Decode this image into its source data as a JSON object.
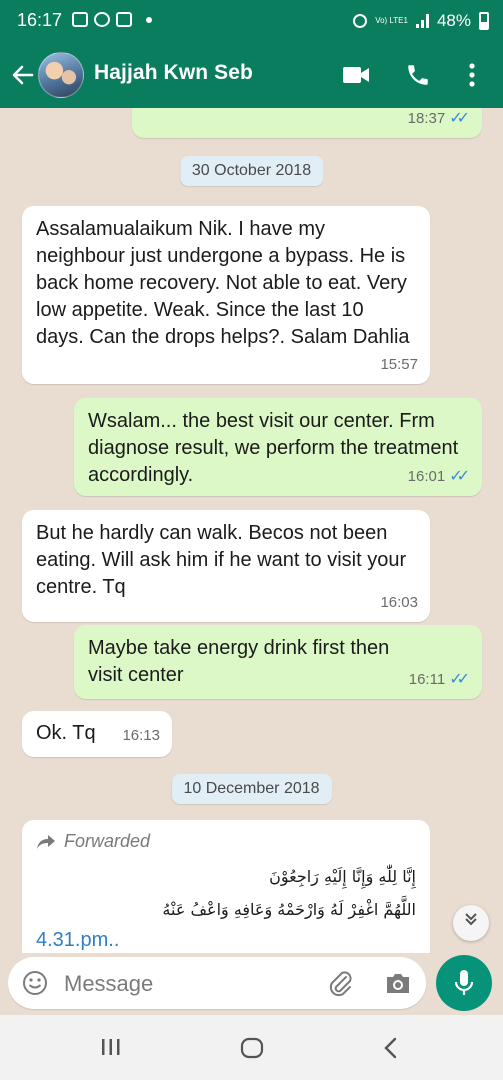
{
  "status_bar": {
    "time": "16:17",
    "network_label": "Vo) LTE1",
    "battery": "48%"
  },
  "header": {
    "contact_name": "Hajjah Kwn Seb"
  },
  "chat": {
    "messages": [
      {
        "direction": "outgoing",
        "text": "",
        "time": "18:37",
        "status": "read"
      },
      {
        "type": "date",
        "text": "30 October 2018"
      },
      {
        "direction": "incoming",
        "text": "Assalamualaikum Nik. I have my neighbour just undergone a bypass. He is back home recovery. Not able to eat. Very low appetite. Weak. Since the last 10 days. Can the drops helps?. Salam Dahlia",
        "time": "15:57"
      },
      {
        "direction": "outgoing",
        "text": "Wsalam... the best visit our center. Frm diagnose result, we perform the treatment accordingly.",
        "time": "16:01",
        "status": "read"
      },
      {
        "direction": "incoming",
        "text": "But he hardly can walk. Becos not been eating. Will ask him if he want to visit your centre. Tq",
        "time": "16:03"
      },
      {
        "direction": "outgoing",
        "text": "Maybe take energy drink first then visit center",
        "time": "16:11",
        "status": "read"
      },
      {
        "direction": "incoming",
        "text": "Ok. Tq",
        "time": "16:13"
      },
      {
        "type": "date",
        "text": "10 December 2018"
      },
      {
        "direction": "incoming",
        "forwarded_label": "Forwarded",
        "arabic_line1": "إِنَّا لِلّٰهِ وَإِنَّا إِلَيْهِ رَاجِعُوْنَ",
        "arabic_line2": "اللَّهُمَّ اغْفِرْ لَهُ وَارْحَمْهُ وَعَافِهِ وَاعْفُ عَنْهُ",
        "link_text": "4.31.pm.."
      }
    ]
  },
  "composer": {
    "placeholder": "Message"
  },
  "colors": {
    "header": "#0a7d5f",
    "outgoing_bubble": "#dcf8c6",
    "incoming_bubble": "#ffffff",
    "accent": "#06937a"
  }
}
